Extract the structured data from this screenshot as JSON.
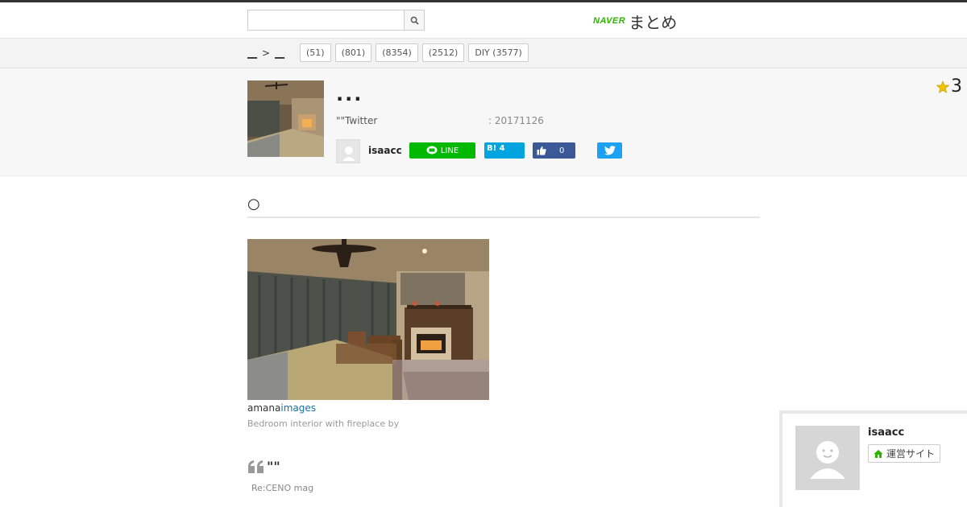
{
  "header": {
    "search_placeholder": "",
    "search_icon": "search-icon",
    "logo_brand": "NAVER",
    "logo_text": "まとめ"
  },
  "breadcrumb": {
    "items": [
      "__",
      "__"
    ],
    "separator": ">"
  },
  "categories": [
    {
      "label": "(51)"
    },
    {
      "label": "(801)"
    },
    {
      "label": "(8354)"
    },
    {
      "label": "(2512)"
    },
    {
      "label": "DIY  (3577)"
    }
  ],
  "summary": {
    "title": "...",
    "description": "\"\"Twitter",
    "date": ": 20171126",
    "author": "isaacc",
    "favorite_count": "3",
    "share": {
      "line_label": "LINE",
      "hatena_label": "B! 4",
      "facebook_count": "0"
    }
  },
  "section": {
    "heading": "○"
  },
  "photo": {
    "credit_part1": "amana",
    "credit_part2": "images",
    "caption": "Bedroom interior with fireplace by"
  },
  "quote": {
    "text": "\"\"",
    "source": "Re:CENO mag"
  },
  "profile": {
    "name": "isaacc",
    "site_label": "運営サイト"
  },
  "colors": {
    "line_green": "#00b900",
    "hatena_blue": "#00a4de",
    "facebook_blue": "#3b5998",
    "twitter_blue": "#1da1f2",
    "naver_green": "#2db400",
    "star_gold": "#f2c200"
  }
}
